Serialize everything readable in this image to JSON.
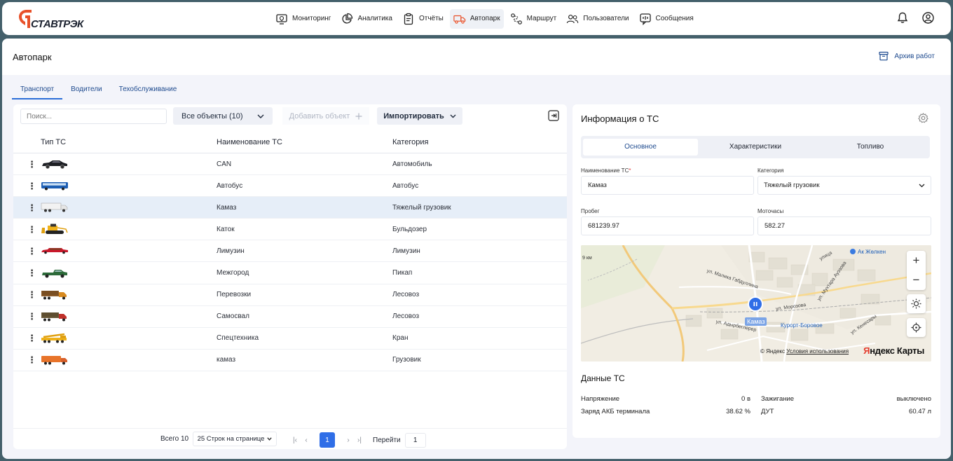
{
  "app": {
    "logo_text": "СТАВТРЭК",
    "nav": [
      {
        "label": "Мониторинг",
        "icon": "monitor-icon"
      },
      {
        "label": "Аналитика",
        "icon": "pie-chart-icon"
      },
      {
        "label": "Отчёты",
        "icon": "clipboard-icon"
      },
      {
        "label": "Автопарк",
        "icon": "truck-icon",
        "active": true
      },
      {
        "label": "Маршрут",
        "icon": "route-icon"
      },
      {
        "label": "Пользователи",
        "icon": "users-icon"
      },
      {
        "label": "Сообщения",
        "icon": "message-icon"
      }
    ]
  },
  "page": {
    "title": "Автопарк",
    "archive_label": "Архив работ",
    "tabs": [
      "Транспорт",
      "Водители",
      "Техобслуживание"
    ]
  },
  "toolbar": {
    "search_placeholder": "Поиск...",
    "filter_label": "Все объекты (10)",
    "add_label": "Добавить объект",
    "import_label": "Импортировать"
  },
  "table": {
    "headers": [
      "Тип ТС",
      "Наименование ТС",
      "Категория"
    ],
    "rows": [
      {
        "vehicle": "car",
        "name": "CAN",
        "category": "Автомобиль"
      },
      {
        "vehicle": "bus",
        "name": "Автобус",
        "category": "Автобус"
      },
      {
        "vehicle": "truck-white",
        "name": "Камаз",
        "category": "Тяжелый грузовик",
        "selected": true
      },
      {
        "vehicle": "bulldozer",
        "name": "Каток",
        "category": "Бульдозер"
      },
      {
        "vehicle": "limousine",
        "name": "Лимузин",
        "category": "Лимузин"
      },
      {
        "vehicle": "pickup",
        "name": "Межгород",
        "category": "Пикап"
      },
      {
        "vehicle": "timber-truck",
        "name": "Перевозки",
        "category": "Лесовоз"
      },
      {
        "vehicle": "timber-truck-red",
        "name": "Самосвал",
        "category": "Лесовоз"
      },
      {
        "vehicle": "crane",
        "name": "Спецтехника",
        "category": "Кран"
      },
      {
        "vehicle": "cargo-truck",
        "name": "камаз",
        "category": "Грузовик"
      }
    ]
  },
  "footer": {
    "total": "Всего 10",
    "per_page": "25 Строк на странице",
    "current_page": "1",
    "goto_label": "Перейти",
    "goto_value": "1"
  },
  "info": {
    "title": "Информация о ТС",
    "tabs": [
      "Основное",
      "Характеристики",
      "Топливо"
    ],
    "name_label": "Наименование ТС",
    "name_value": "Камаз",
    "category_label": "Категория",
    "category_value": "Тяжелый грузовик",
    "mileage_label": "Пробег",
    "mileage_value": "681239.97",
    "hours_label": "Моточасы",
    "hours_value": "582.27"
  },
  "map": {
    "marker_label": "Камаз",
    "copyright_prefix": "© Яндекс",
    "terms_link": "Условия использования",
    "brand_y": "Я",
    "brand_rest": "ндекс Карты",
    "labels": {
      "km": "9 км",
      "poi": "Ак Жөлкен",
      "street1": "ул. Малика Габдуллина",
      "street2": "ул. Морозова",
      "street3": "ул. Мухтара Ауэзова",
      "street4": "ул. Адырбеглерер",
      "street5": "ул. Кенесары",
      "station": "Курорт-Боровое",
      "street6": "улица"
    }
  },
  "data": {
    "title": "Данные ТС",
    "items": [
      {
        "label": "Напряжение",
        "value": "0 в"
      },
      {
        "label": "Заряд АКБ терминала",
        "value": "38.62 %"
      },
      {
        "label": "Зажигание",
        "value": "выключено"
      },
      {
        "label": "ДУТ",
        "value": "60.47 л"
      }
    ]
  }
}
